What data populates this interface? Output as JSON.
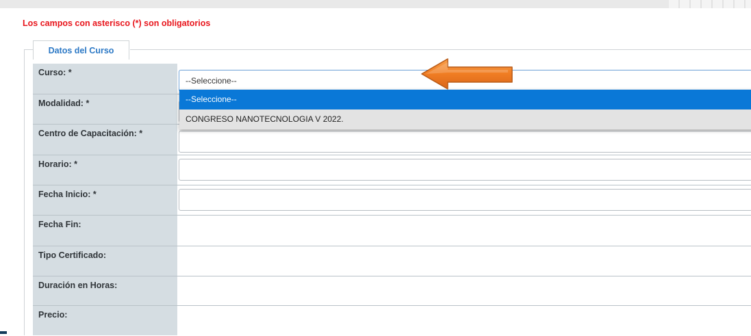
{
  "notice": "Los campos con asterisco (*) son obligatorios",
  "section_title": "Datos del Curso",
  "fields": [
    {
      "label": "Curso: *"
    },
    {
      "label": "Modalidad: *"
    },
    {
      "label": "Centro de Capacitación: *"
    },
    {
      "label": "Horario: *"
    },
    {
      "label": "Fecha Inicio: *"
    },
    {
      "label": "Fecha Fin:"
    },
    {
      "label": "Tipo Certificado:"
    },
    {
      "label": "Duración en Horas:"
    },
    {
      "label": "Precio:"
    }
  ],
  "curso_select": {
    "value": "--Seleccione--",
    "options": [
      "--Seleccione--",
      "CONGRESO NANOTECNOLOGIA V 2022."
    ]
  },
  "colors": {
    "required_note": "#e8141b",
    "legend_text": "#2b78c5",
    "label_column": "#d5dde2",
    "selected_option": "#0a78d7",
    "arrow": "#f07d23"
  },
  "icons": {
    "pointer": "orange-arrow-icon"
  }
}
